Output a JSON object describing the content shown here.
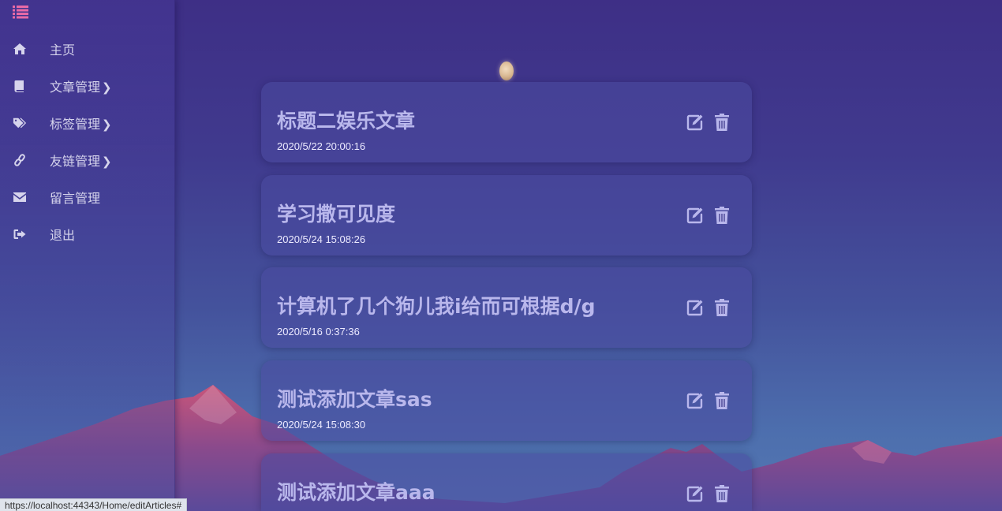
{
  "sidebar": {
    "menu_icon": "list-icon",
    "items": [
      {
        "label": "主页",
        "icon": "home-icon",
        "has_caret": false
      },
      {
        "label": "文章管理",
        "icon": "book-icon",
        "has_caret": true
      },
      {
        "label": "标签管理",
        "icon": "tags-icon",
        "has_caret": true
      },
      {
        "label": "友链管理",
        "icon": "link-icon",
        "has_caret": true
      },
      {
        "label": "留言管理",
        "icon": "envelope-icon",
        "has_caret": false
      },
      {
        "label": "退出",
        "icon": "sign-out-icon",
        "has_caret": false
      }
    ],
    "caret": "❯"
  },
  "articles": [
    {
      "title": "标题二娱乐文章",
      "date": "2020/5/22 20:00:16"
    },
    {
      "title": "学习撒可见度",
      "date": "2020/5/24 15:08:26"
    },
    {
      "title": "计算机了几个狗儿我i给而可根据d/g",
      "date": "2020/5/16 0:37:36"
    },
    {
      "title": "测试添加文章sas",
      "date": "2020/5/24 15:08:30"
    },
    {
      "title": "测试添加文章aaa",
      "date": ""
    }
  ],
  "actions": {
    "edit_icon": "edit-icon",
    "delete_icon": "trash-icon"
  },
  "status_bar": {
    "url": "https://localhost:44343/Home/editArticles#"
  },
  "colors": {
    "accent": "#e86aa6",
    "icon": "#b9b7ec",
    "text": "#d6d4ec"
  }
}
